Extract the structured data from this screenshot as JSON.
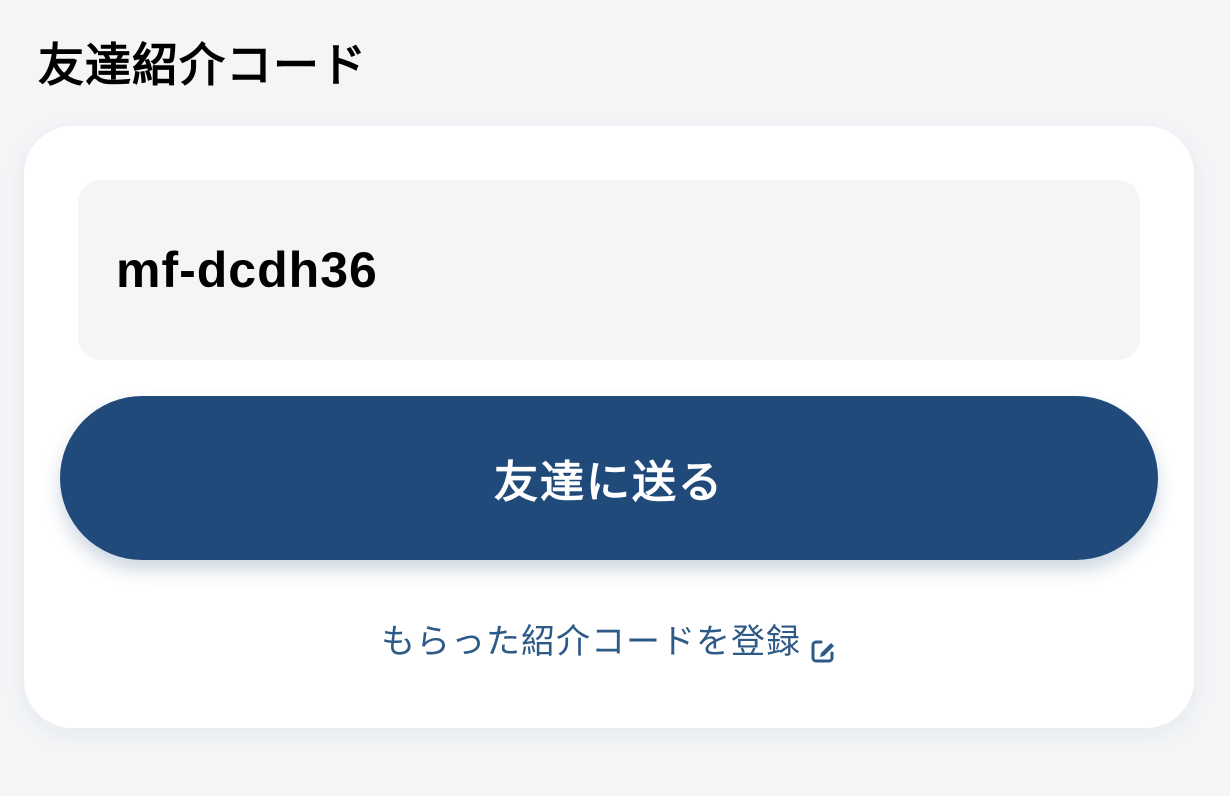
{
  "page": {
    "title": "友達紹介コード"
  },
  "referral": {
    "code": "mf-dcdh36",
    "send_button_label": "友達に送る",
    "register_link_label": "もらった紹介コードを登録",
    "register_link_icon": "edit-external-icon"
  },
  "colors": {
    "background": "#f3f5f7",
    "card": "#ffffff",
    "button": "#204a7a",
    "link": "#2d5a86"
  }
}
